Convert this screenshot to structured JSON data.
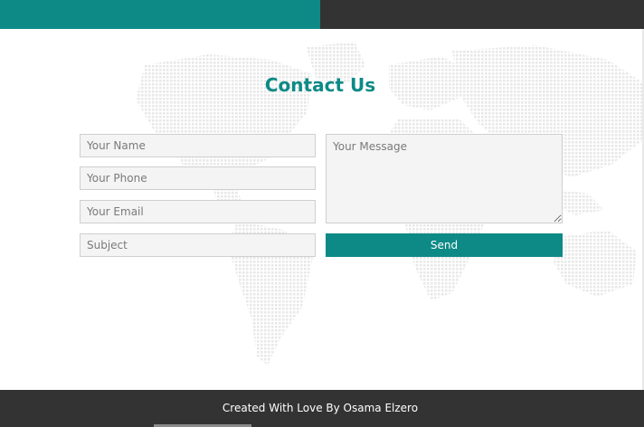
{
  "header": {
    "accent_color": "#0d8a86",
    "dark_color": "#333333"
  },
  "contact": {
    "title": "Contact Us",
    "name_placeholder": "Your Name",
    "phone_placeholder": "Your Phone",
    "email_placeholder": "Your Email",
    "subject_placeholder": "Subject",
    "message_placeholder": "Your Message",
    "send_label": "Send"
  },
  "footer": {
    "text": "Created With Love By Osama Elzero"
  },
  "icons": {
    "background": "world-map-icon"
  }
}
